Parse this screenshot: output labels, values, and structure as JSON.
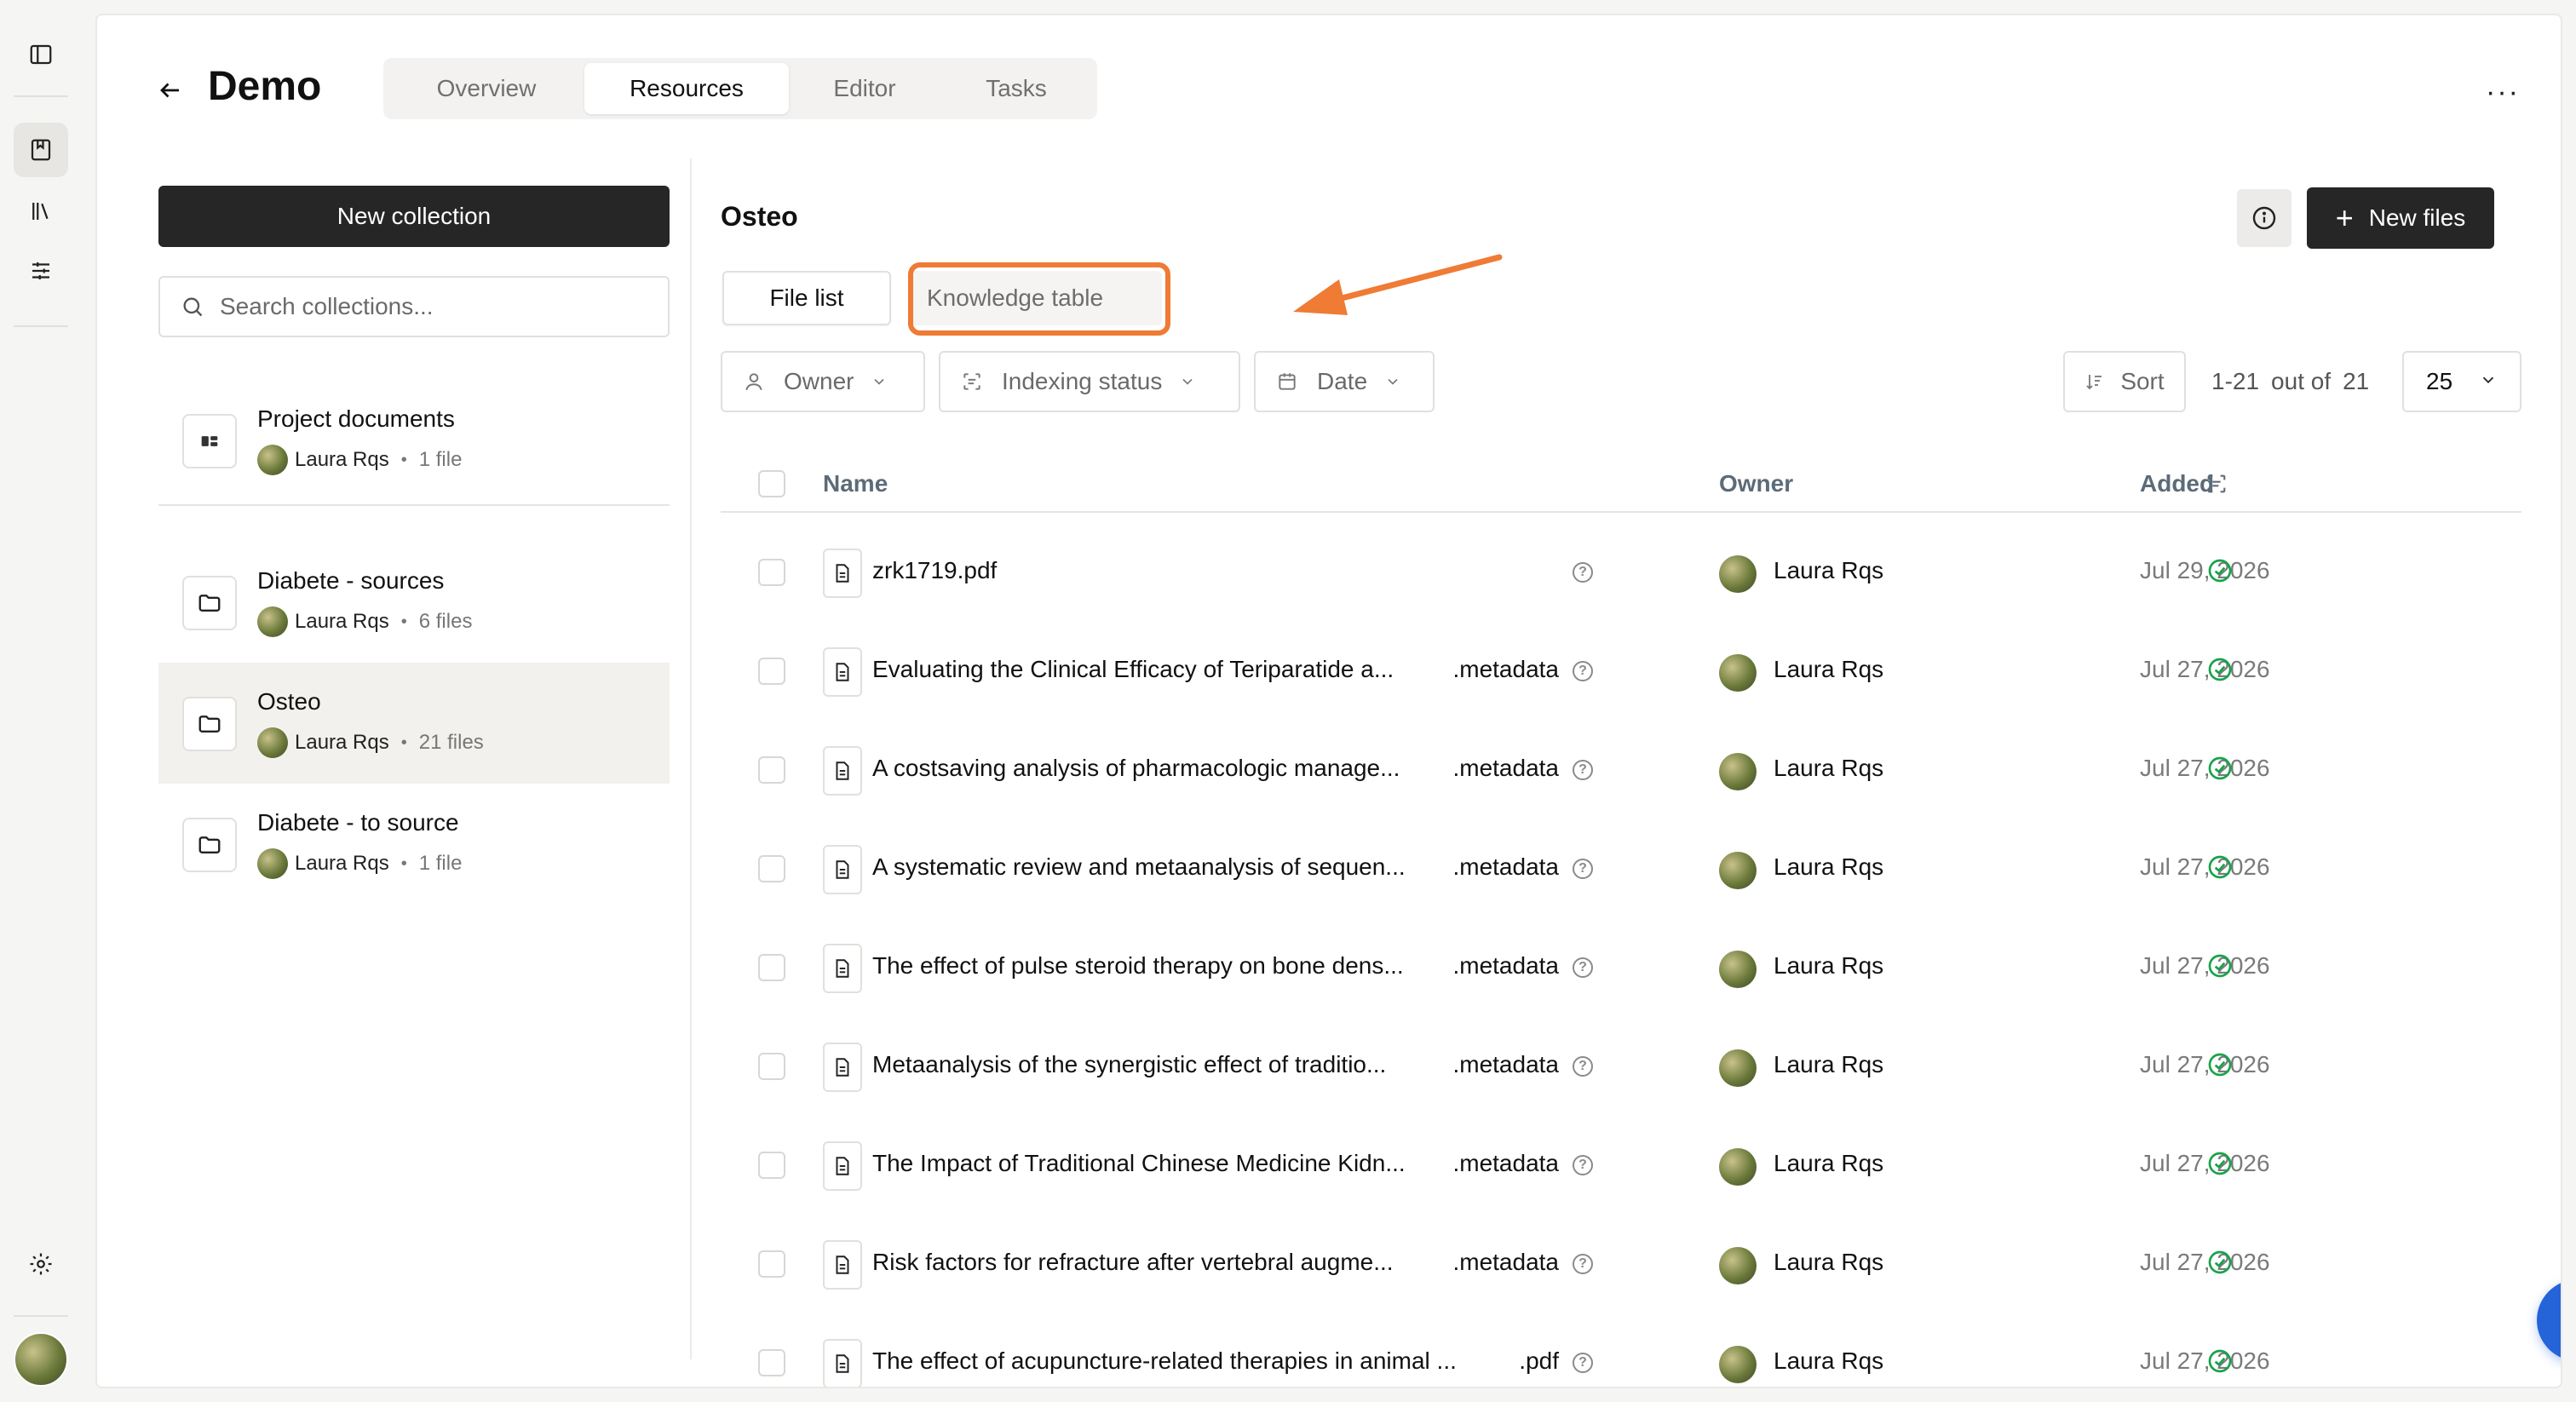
{
  "header": {
    "title": "Demo",
    "tabs": [
      "Overview",
      "Resources",
      "Editor",
      "Tasks"
    ],
    "active_tab": "Resources",
    "more": "···"
  },
  "sidebar": {
    "new_collection": "New collection",
    "search_placeholder": "Search collections...",
    "collections": [
      {
        "name": "Project documents",
        "owner": "Laura Rqs",
        "count": "1 file"
      },
      {
        "name": "Diabete - sources",
        "owner": "Laura Rqs",
        "count": "6 files"
      },
      {
        "name": "Osteo",
        "owner": "Laura Rqs",
        "count": "21 files"
      },
      {
        "name": "Diabete - to source",
        "owner": "Laura Rqs",
        "count": "1 file"
      }
    ],
    "dot": "•"
  },
  "collection": {
    "title": "Osteo",
    "new_files": "New files",
    "views": {
      "file_list": "File list",
      "knowledge_table": "Knowledge table"
    },
    "filters": {
      "owner": "Owner",
      "indexing": "Indexing status",
      "date": "Date"
    },
    "sort": "Sort",
    "pager": {
      "range": "1-21",
      "out_of": "out of",
      "total": "21"
    },
    "per_page": "25",
    "columns": {
      "name": "Name",
      "owner": "Owner",
      "added": "Added"
    }
  },
  "files": [
    {
      "name": "zrk1719.pdf",
      "ext": "",
      "owner": "Laura Rqs",
      "added": "Jul 29, 2026"
    },
    {
      "name": "Evaluating the Clinical Efficacy of Teriparatide a...",
      "ext": ".metadata",
      "owner": "Laura Rqs",
      "added": "Jul 27, 2026"
    },
    {
      "name": "A costsaving analysis of pharmacologic manage...",
      "ext": ".metadata",
      "owner": "Laura Rqs",
      "added": "Jul 27, 2026"
    },
    {
      "name": "A systematic review and metaanalysis of sequen...",
      "ext": ".metadata",
      "owner": "Laura Rqs",
      "added": "Jul 27, 2026"
    },
    {
      "name": "The effect of pulse steroid therapy on bone dens...",
      "ext": ".metadata",
      "owner": "Laura Rqs",
      "added": "Jul 27, 2026"
    },
    {
      "name": "Metaanalysis of the synergistic effect of traditio...",
      "ext": ".metadata",
      "owner": "Laura Rqs",
      "added": "Jul 27, 2026"
    },
    {
      "name": "The Impact of Traditional Chinese Medicine Kidn...",
      "ext": ".metadata",
      "owner": "Laura Rqs",
      "added": "Jul 27, 2026"
    },
    {
      "name": "Risk factors for refracture after vertebral augme...",
      "ext": ".metadata",
      "owner": "Laura Rqs",
      "added": "Jul 27, 2026"
    },
    {
      "name": "The effect of acupuncture-related therapies in animal ...",
      "ext": ".pdf",
      "owner": "Laura Rqs",
      "added": "Jul 27, 2026"
    }
  ],
  "colors": {
    "accent_orange": "#ef7b35",
    "dark_button": "#262626",
    "success": "#16a34a",
    "chat_blue": "#2563d9"
  }
}
